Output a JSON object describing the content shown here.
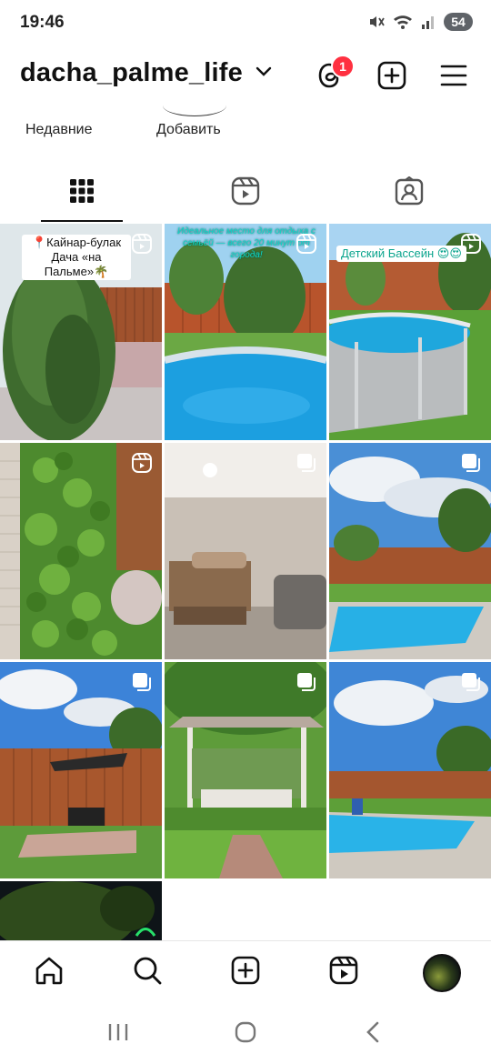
{
  "status_bar": {
    "time": "19:46",
    "battery": "54",
    "icons": [
      "mute-icon",
      "wifi-icon",
      "signal-icon",
      "battery-icon"
    ]
  },
  "header": {
    "username": "dacha_palme_life",
    "threads_badge": "1",
    "icons": [
      "chevron-down-icon",
      "threads-icon",
      "add-post-icon",
      "menu-icon"
    ]
  },
  "highlights": [
    {
      "label": "Недавние"
    },
    {
      "label": "Добавить"
    }
  ],
  "tabs": [
    {
      "name": "posts-grid",
      "icon": "grid-icon",
      "active": true
    },
    {
      "name": "reels",
      "icon": "reels-icon",
      "active": false
    },
    {
      "name": "tagged",
      "icon": "tagged-icon",
      "active": false
    }
  ],
  "grid": {
    "tiles": [
      {
        "kind": "reel",
        "scene": "tree-garden",
        "overlay": "📍Кайнар-булак Дача «на Пальме»🌴"
      },
      {
        "kind": "reel",
        "scene": "pool-fence",
        "overlay": "Идеальное место для отдыха с семьёй — всего 20 минут от города!"
      },
      {
        "kind": "reel",
        "scene": "pool-frame",
        "overlay": "Детский Бассейн 😍😍"
      },
      {
        "kind": "reel",
        "scene": "vines",
        "overlay": ""
      },
      {
        "kind": "carousel",
        "scene": "bedroom",
        "overlay": ""
      },
      {
        "kind": "carousel",
        "scene": "pool-sky",
        "overlay": ""
      },
      {
        "kind": "carousel",
        "scene": "bbq-fence",
        "overlay": ""
      },
      {
        "kind": "carousel",
        "scene": "gazebo",
        "overlay": ""
      },
      {
        "kind": "carousel",
        "scene": "pool-deck",
        "overlay": ""
      },
      {
        "kind": "photo",
        "scene": "night",
        "overlay": ""
      }
    ]
  },
  "bottom_nav": {
    "items": [
      "home-icon",
      "search-icon",
      "create-icon",
      "reels-icon",
      "profile-avatar"
    ]
  },
  "system_nav": {
    "items": [
      "recent-apps-icon",
      "home-button-icon",
      "back-icon"
    ]
  },
  "colors": {
    "accent_badge": "#ff3040",
    "text": "#111111",
    "pool_water": "#1aa7e0",
    "fence": "#a0522d",
    "grass": "#5fa83a"
  }
}
